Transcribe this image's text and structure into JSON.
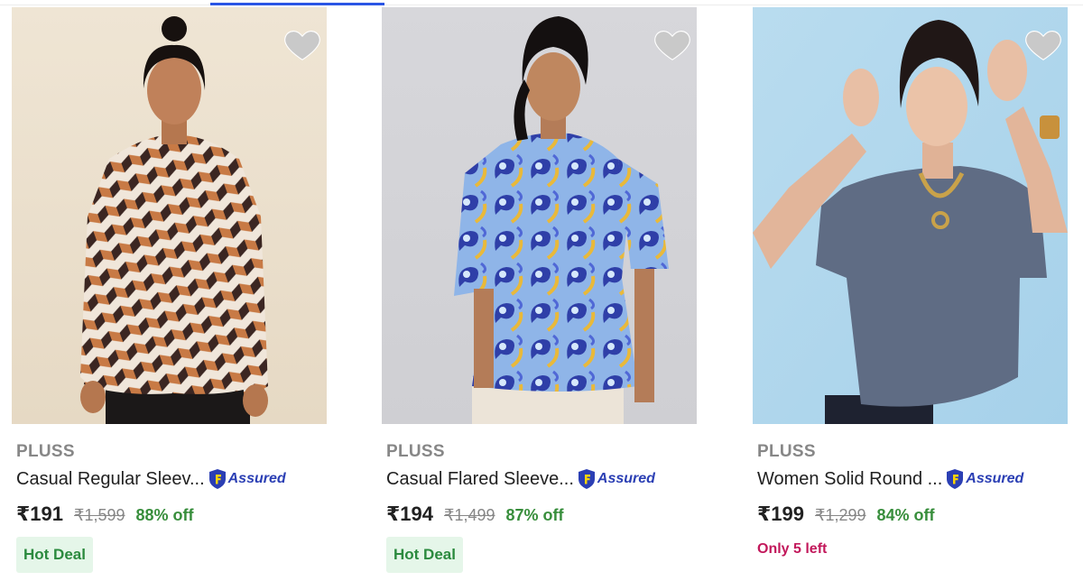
{
  "colors": {
    "accent": "#2a55e5",
    "discount_green": "#388e3c",
    "deal_bg": "#e5f6e9",
    "stock_warning": "#c2185b",
    "assured_blue": "#2b3fb4"
  },
  "products": [
    {
      "brand": "PLUSS",
      "title": "Casual Regular Sleev...",
      "assured_label": "Assured",
      "price": "₹191",
      "mrp": "₹1,599",
      "discount": "88% off",
      "tag": "Hot Deal",
      "image_icon": "product-photo-geometric-print-shirt"
    },
    {
      "brand": "PLUSS",
      "title": "Casual Flared Sleeve...",
      "assured_label": "Assured",
      "price": "₹194",
      "mrp": "₹1,499",
      "discount": "87% off",
      "tag": "Hot Deal",
      "image_icon": "product-photo-paisley-print-top"
    },
    {
      "brand": "PLUSS",
      "title": "Women Solid Round ...",
      "assured_label": "Assured",
      "price": "₹199",
      "mrp": "₹1,299",
      "discount": "84% off",
      "stock_note": "Only 5 left",
      "image_icon": "product-photo-grey-tshirt"
    }
  ]
}
